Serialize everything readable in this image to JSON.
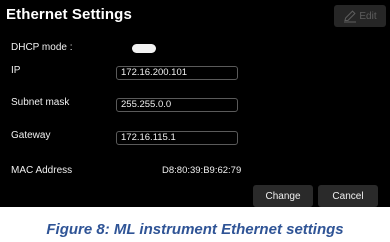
{
  "panel": {
    "title": "Ethernet Settings",
    "edit_label": "Edit",
    "dhcp_label": "DHCP mode :",
    "dhcp_enabled": false,
    "fields": {
      "ip_label": "IP",
      "ip_value": "172.16.200.101",
      "subnet_label": "Subnet mask",
      "subnet_value": "255.255.0.0",
      "gateway_label": "Gateway",
      "gateway_value": "172.16.115.1",
      "mac_label": "MAC Address",
      "mac_value": "D8:80:39:B9:62:79"
    },
    "change_label": "Change",
    "cancel_label": "Cancel"
  },
  "caption": "Figure 8: ML instrument Ethernet settings",
  "colors": {
    "panel_background": "#000000",
    "caption_color": "#2f5496"
  },
  "icons": {
    "edit": "pencil-icon"
  }
}
